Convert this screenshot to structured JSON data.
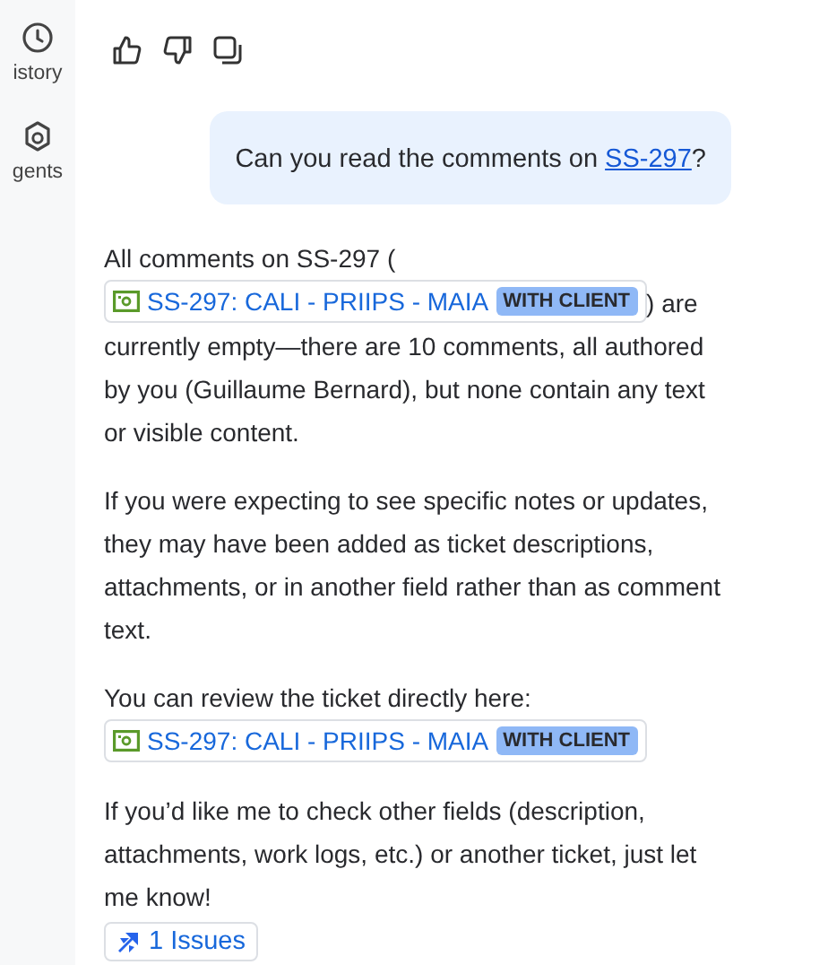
{
  "sidebar": {
    "items": [
      {
        "label": "istory"
      },
      {
        "label": "gents"
      }
    ]
  },
  "user_message": {
    "before": "Can you read the comments on ",
    "link": "SS-297",
    "after": "?"
  },
  "reply": [
    {
      "kind": "mixed",
      "before": "All comments on SS-297 (",
      "ticket": {
        "title": "SS-297: CALI - PRIIPS - MAIA",
        "status": "WITH CLIENT"
      },
      "after": ") are currently empty—there are 10 comments, all authored by you (Guillaume Bernard), but none contain any text or visible content."
    },
    {
      "kind": "text",
      "text": "If you were expecting to see specific notes or updates, they may have been added as ticket descriptions, attachments, or in another field rather than as comment text."
    },
    {
      "kind": "chip",
      "text": "You can review the ticket directly here:",
      "ticket": {
        "title": "SS-297: CALI - PRIIPS - MAIA",
        "status": "WITH CLIENT"
      }
    },
    {
      "kind": "text",
      "text": "If you’d like me to check other fields (description, attachments, work logs, etc.) or another ticket, just let me know!"
    }
  ],
  "issues_button": "1 Issues"
}
